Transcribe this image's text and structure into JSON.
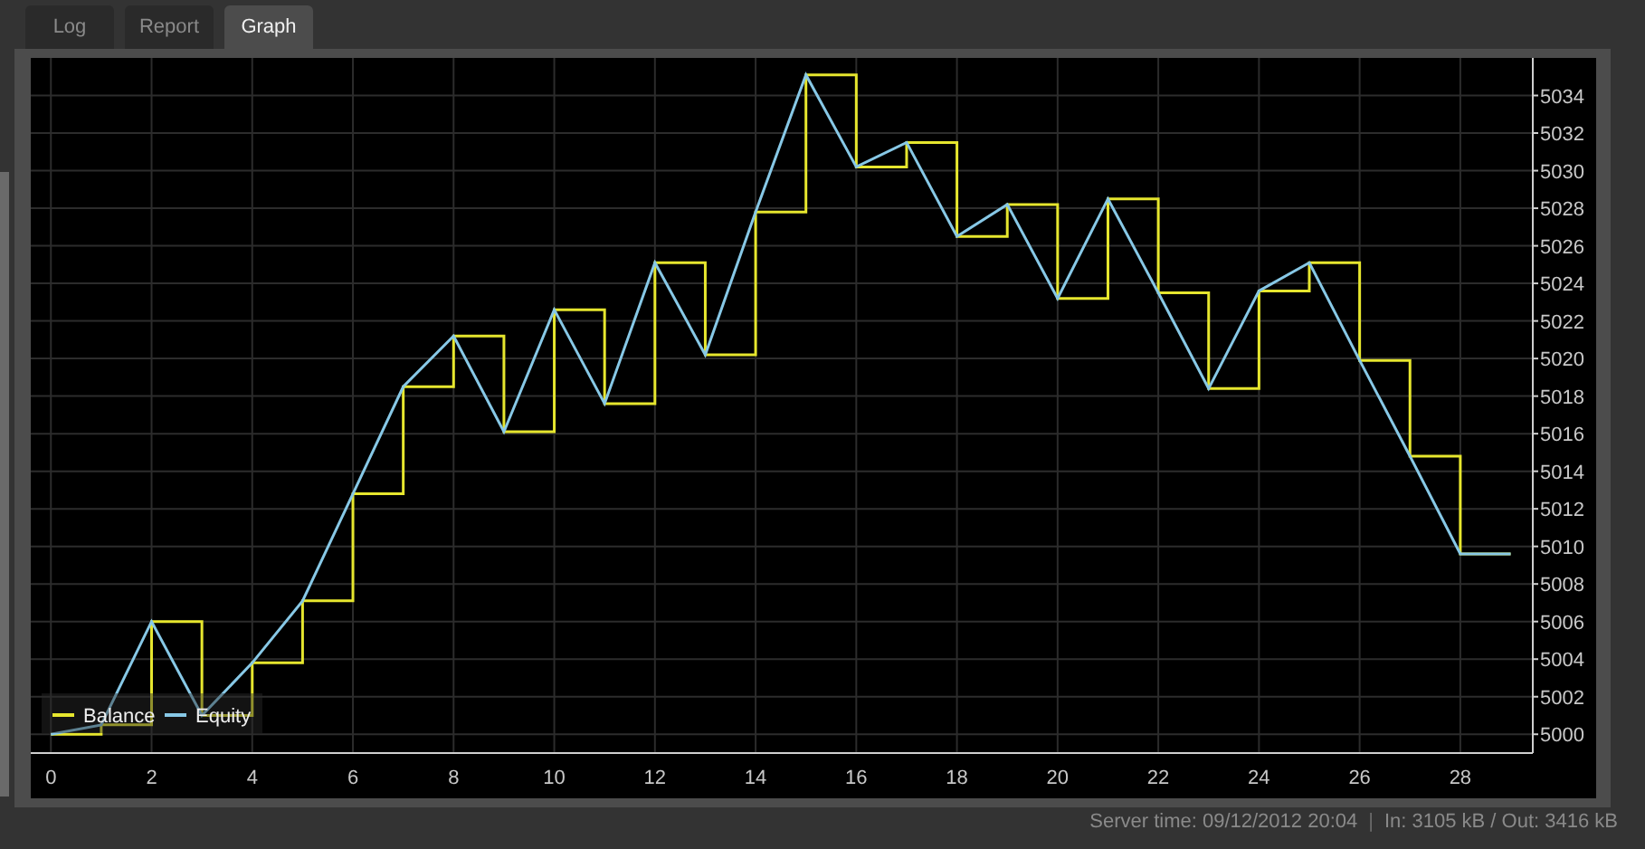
{
  "tabs": [
    {
      "label": "Log",
      "selected": false
    },
    {
      "label": "Report",
      "selected": false
    },
    {
      "label": "Graph",
      "selected": true
    }
  ],
  "chart": {
    "chart_data": {
      "type": "line",
      "x": [
        0,
        1,
        1,
        2,
        2,
        3,
        3,
        4,
        4,
        5,
        5,
        6,
        6,
        7,
        7,
        8,
        8,
        9,
        9,
        10,
        10,
        11,
        11,
        12,
        12,
        13,
        13,
        14,
        14,
        15,
        15,
        16,
        16,
        17,
        17,
        18,
        18,
        19,
        19,
        20,
        20,
        21,
        21,
        22,
        22,
        23,
        23,
        24,
        24,
        25,
        25,
        26,
        26,
        27,
        27,
        28,
        28,
        29,
        29
      ],
      "series": [
        {
          "name": "Balance",
          "color": "#e6e62e",
          "values": [
            5000,
            5000,
            5000.5,
            5000.5,
            5006,
            5006,
            5001,
            5001,
            5003.8,
            5003.8,
            5007.1,
            5007.1,
            5012.8,
            5012.8,
            5018.5,
            5018.5,
            5021.2,
            5021.2,
            5016.1,
            5016.1,
            5022.6,
            5022.6,
            5017.6,
            5017.6,
            5025.1,
            5025.1,
            5020.2,
            5020.2,
            5027.8,
            5027.8,
            5035.1,
            5035.1,
            5030.2,
            5030.2,
            5031.5,
            5031.5,
            5026.5,
            5026.5,
            5028.2,
            5028.2,
            5023.2,
            5023.2,
            5028.5,
            5028.5,
            5023.5,
            5023.5,
            5018.4,
            5018.4,
            5023.6,
            5023.6,
            5025.1,
            5025.1,
            5019.9,
            5019.9,
            5014.8,
            5014.8,
            5009.6,
            5009.6,
            5009.6
          ]
        },
        {
          "name": "Equity",
          "color": "#87c8e6",
          "values": [
            5000,
            5000.5,
            5000.5,
            5006,
            5006,
            5001,
            5001,
            5003.8,
            5003.8,
            5007.1,
            5007.1,
            5012.8,
            5012.8,
            5018.5,
            5018.5,
            5021.2,
            5021.2,
            5016.1,
            5016.1,
            5022.6,
            5022.6,
            5017.6,
            5017.6,
            5025.1,
            5025.1,
            5020.2,
            5020.2,
            5027.8,
            5027.8,
            5035.1,
            5035.1,
            5030.2,
            5030.2,
            5031.5,
            5031.5,
            5026.5,
            5026.5,
            5028.2,
            5028.2,
            5023.2,
            5023.2,
            5028.5,
            5028.5,
            5023.5,
            5023.5,
            5018.4,
            5018.4,
            5023.6,
            5023.6,
            5025.1,
            5025.1,
            5019.9,
            5019.9,
            5014.8,
            5014.8,
            5009.6,
            5009.6,
            5009.6,
            5009.6
          ]
        }
      ],
      "grid": true,
      "legend": true,
      "xlim": [
        -0.4,
        29.44
      ],
      "ylim": [
        4999,
        5036
      ],
      "xticks": [
        0,
        2,
        4,
        6,
        8,
        10,
        12,
        14,
        16,
        18,
        20,
        22,
        24,
        26,
        28
      ],
      "yticks": [
        5000,
        5002,
        5004,
        5006,
        5008,
        5010,
        5012,
        5014,
        5016,
        5018,
        5020,
        5022,
        5024,
        5026,
        5028,
        5030,
        5032,
        5034
      ]
    }
  },
  "status_bar": {
    "server_time": "Server time: 09/12/2012 20:04",
    "separator": "|",
    "traffic": "In: 3105 kB / Out: 3416 kB"
  }
}
